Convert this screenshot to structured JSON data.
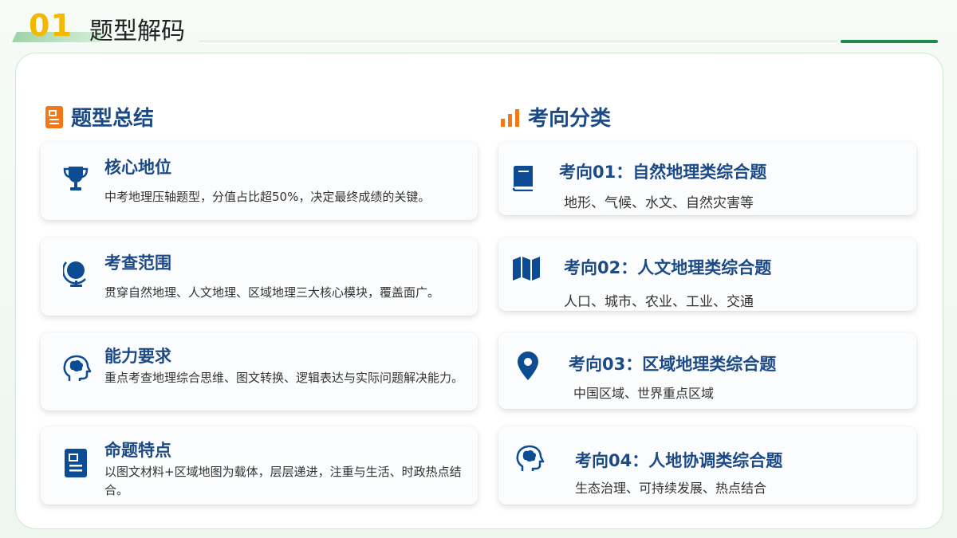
{
  "header": {
    "number": "01",
    "title": "题型解码"
  },
  "left": {
    "title": "题型总结",
    "icon": "document-icon",
    "cards": [
      {
        "title": "核心地位",
        "icon": "trophy-icon",
        "desc": "中考地理压轴题型，分值占比超50%，决定最终成绩的关键。"
      },
      {
        "title": "考查范围",
        "icon": "globe-icon",
        "desc": "贯穿自然地理、人文地理、区域地理三大核心模块，覆盖面广。"
      },
      {
        "title": "能力要求",
        "icon": "brain-head-icon",
        "desc": "重点考查地理综合思维、图文转换、逻辑表达与实际问题解决能力。"
      },
      {
        "title": "命题特点",
        "icon": "newspaper-icon",
        "desc": "以图文材料+区域地图为载体，层层递进，注重与生活、时政热点结合。"
      }
    ]
  },
  "right": {
    "title": "考向分类",
    "icon": "bar-chart-icon",
    "cards": [
      {
        "title": "考向01：自然地理类综合题",
        "icon": "book-icon",
        "desc": "地形、气候、水文、自然灾害等"
      },
      {
        "title": "考向02：人文地理类综合题",
        "icon": "map-icon",
        "desc": "人口、城市、农业、工业、交通"
      },
      {
        "title": "考向03：区域地理类综合题",
        "icon": "location-pin-icon",
        "desc": "中国区域、世界重点区域"
      },
      {
        "title": "考向04：人地协调类综合题",
        "icon": "brain-head-icon",
        "desc": "生态治理、可持续发展、热点结合"
      }
    ]
  },
  "colors": {
    "title_blue": "#1c4a86",
    "icon_blue": "#0b4c94",
    "accent_orange": "#f07818",
    "number_gold": "#f4b800",
    "accent_green": "#1e8a4c"
  }
}
